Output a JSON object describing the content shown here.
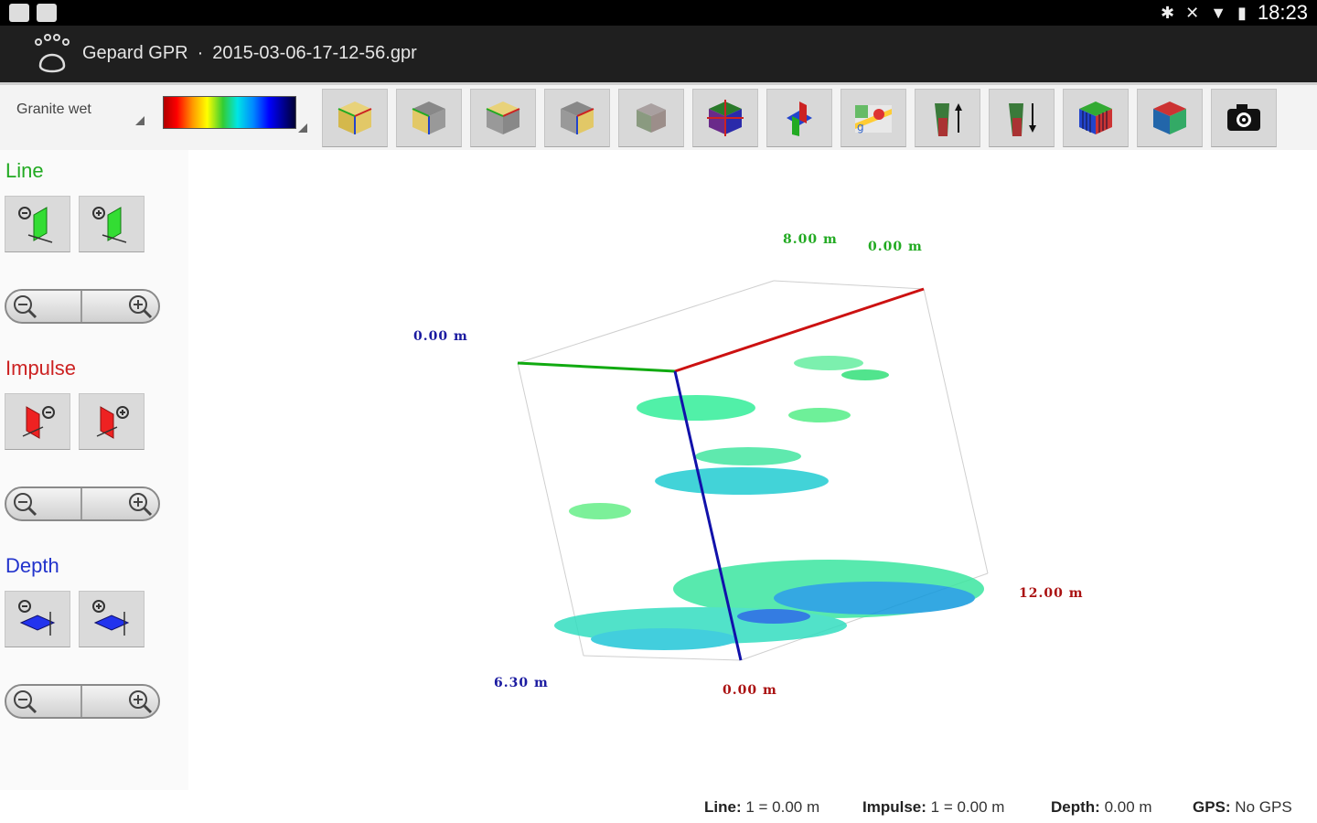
{
  "status_bar": {
    "time": "18:23",
    "left_icons": [
      "gallery-icon",
      "screenshot-icon"
    ],
    "right_icons": [
      "bluetooth-icon",
      "mute-icon",
      "wifi-icon",
      "battery-icon"
    ]
  },
  "app_bar": {
    "app_name": "Gepard GPR",
    "separator": "·",
    "file_name": "2015-03-06-17-12-56.gpr"
  },
  "toolbar": {
    "material_selected": "Granite wet",
    "colormap": "rainbow",
    "buttons": [
      "view-front-icon",
      "view-back-icon",
      "view-left-icon",
      "view-right-icon",
      "view-solid-icon",
      "slices-icon",
      "axes-icon",
      "maps-icon",
      "depth-up-icon",
      "depth-down-icon",
      "volume-grid-icon",
      "volume-solid-icon",
      "camera-icon"
    ]
  },
  "left_panel": {
    "line": {
      "title": "Line",
      "color": "#22aa22"
    },
    "impulse": {
      "title": "Impulse",
      "color": "#cc2222"
    },
    "depth": {
      "title": "Depth",
      "color": "#2233cc"
    }
  },
  "viewport": {
    "labels": {
      "top_green": "8.00 m",
      "top_right": "0.00 m",
      "left_blue": "0.00 m",
      "right_red": "12.00 m",
      "bottom_left_blue": "6.30 m",
      "bottom_red": "0.00 m"
    },
    "axis_colors": {
      "x": "#cc1111",
      "y": "#11aa11",
      "z": "#1111aa"
    }
  },
  "footer": {
    "line_label": "Line:",
    "line_value": "1 = 0.00 m",
    "impulse_label": "Impulse:",
    "impulse_value": "1 = 0.00 m",
    "depth_label": "Depth:",
    "depth_value": "0.00 m",
    "gps_label": "GPS:",
    "gps_value": "No GPS"
  }
}
